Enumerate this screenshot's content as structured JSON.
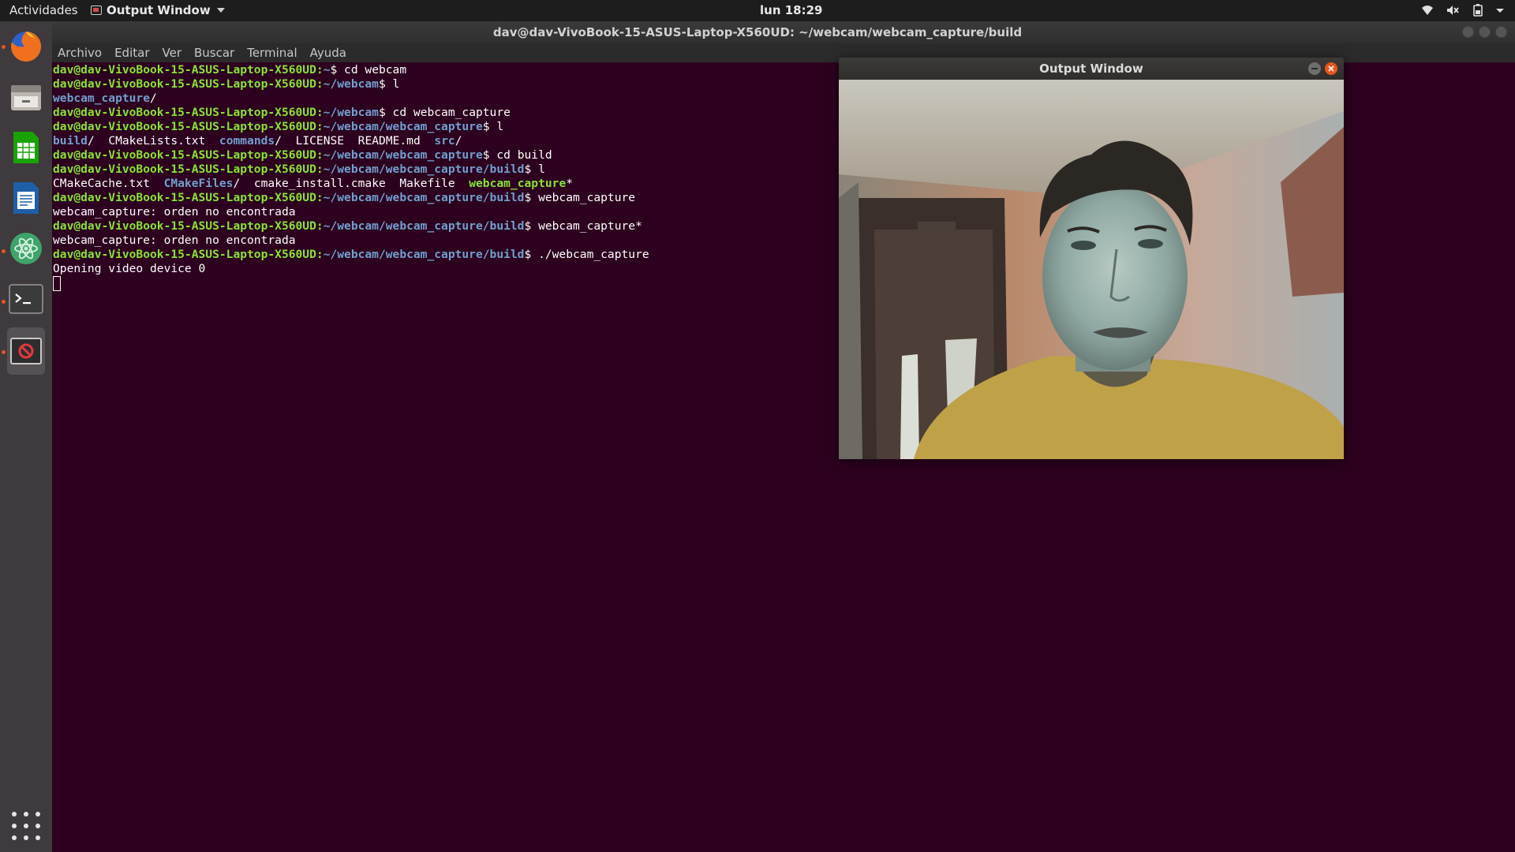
{
  "topbar": {
    "activities": "Actividades",
    "app_menu_label": "Output Window",
    "clock": "lun 18:29",
    "tray_icons": [
      "wifi-icon",
      "volume-icon",
      "battery-icon",
      "system-menu-caret-icon"
    ]
  },
  "terminal_window": {
    "title": "dav@dav-VivoBook-15-ASUS-Laptop-X560UD: ~/webcam/webcam_capture/build",
    "menu": [
      "Archivo",
      "Editar",
      "Ver",
      "Buscar",
      "Terminal",
      "Ayuda"
    ],
    "user_host": "dav@dav-VivoBook-15-ASUS-Laptop-X560UD",
    "lines": [
      {
        "path": "~",
        "cmd": " cd webcam"
      },
      {
        "path": "~/webcam",
        "cmd": " l"
      },
      {
        "out": "webcam_capture/"
      },
      {
        "path": "~/webcam",
        "cmd": " cd webcam_capture"
      },
      {
        "path": "~/webcam/webcam_capture",
        "cmd": " l"
      },
      {
        "out": "build/  CMakeLists.txt  commands/  LICENSE  README.md  src/"
      },
      {
        "path": "~/webcam/webcam_capture",
        "cmd": " cd build"
      },
      {
        "path": "~/webcam/webcam_capture/build",
        "cmd": " l"
      },
      {
        "out": "CMakeCache.txt  CMakeFiles/  cmake_install.cmake  Makefile  webcam_capture*"
      },
      {
        "path": "~/webcam/webcam_capture/build",
        "cmd": " webcam_capture"
      },
      {
        "out": "webcam_capture: orden no encontrada"
      },
      {
        "path": "~/webcam/webcam_capture/build",
        "cmd": " webcam_capture*"
      },
      {
        "out": "webcam_capture: orden no encontrada"
      },
      {
        "path": "~/webcam/webcam_capture/build",
        "cmd": " ./webcam_capture"
      },
      {
        "out": "Opening video device 0"
      }
    ]
  },
  "output_window": {
    "title": "Output Window",
    "content": "webcam-video-frame"
  },
  "dock": {
    "items": [
      "firefox-icon",
      "files-icon",
      "calc-icon",
      "writer-icon",
      "atom-icon",
      "terminal-icon",
      "output-window-icon"
    ],
    "show_apps": "show-applications-icon"
  },
  "colors": {
    "terminal_bg": "#2c001e",
    "prompt_user": "#8ae234",
    "prompt_path": "#729fcf",
    "accent": "#e95420"
  }
}
